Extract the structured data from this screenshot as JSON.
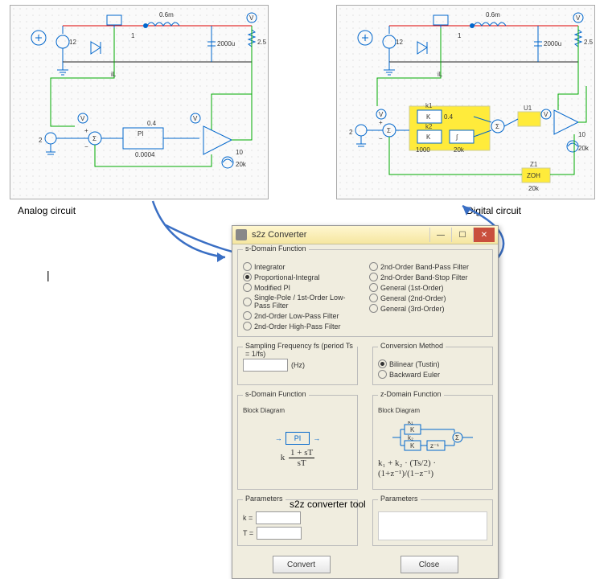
{
  "labels": {
    "analog": "Analog circuit",
    "digital": "Digital circuit",
    "tool": "s2z converter tool"
  },
  "circuit_values": {
    "inductor": "0.6m",
    "r1": "1",
    "cap": "2000u",
    "rout": "2.5",
    "vdc": "12",
    "iL": "iL",
    "vref": "2",
    "pi_gain": "0.4",
    "pi_tc": "0.0004",
    "pi_label": "PI",
    "gain_out": "10",
    "freq_out": "20k",
    "k1_label": "k1",
    "k2_label": "k2",
    "k_block": "K",
    "k1_val": "0.4",
    "k2_val": "1000",
    "int_bounds": "20k",
    "zoh_label": "ZOH",
    "zoh_rate": "20k",
    "u1": "U1",
    "z1": "Z1"
  },
  "dialog": {
    "title": "s2z Converter",
    "group_sdomain_fn": "s-Domain Function",
    "radios_left": [
      {
        "label": "Integrator",
        "sel": false
      },
      {
        "label": "Proportional-Integral",
        "sel": true
      },
      {
        "label": "Modified PI",
        "sel": false
      },
      {
        "label": "Single-Pole / 1st-Order Low-Pass Filter",
        "sel": false
      },
      {
        "label": "2nd-Order Low-Pass Filter",
        "sel": false
      },
      {
        "label": "2nd-Order High-Pass Filter",
        "sel": false
      }
    ],
    "radios_right": [
      {
        "label": "2nd-Order Band-Pass Filter",
        "sel": false
      },
      {
        "label": "2nd-Order Band-Stop Filter",
        "sel": false
      },
      {
        "label": "General (1st-Order)",
        "sel": false
      },
      {
        "label": "General (2nd-Order)",
        "sel": false
      },
      {
        "label": "General (3rd-Order)",
        "sel": false
      }
    ],
    "sampling_label": "Sampling Frequency fs (period Ts = 1/fs)",
    "sampling_unit": "(Hz)",
    "conv_method": "Conversion Method",
    "conv_opts": [
      {
        "label": "Bilinear (Tustin)",
        "sel": true
      },
      {
        "label": "Backward Euler",
        "sel": false
      }
    ],
    "s_block_title": "s-Domain Function",
    "z_block_title": "z-Domain Function",
    "block_diagram": "Block Diagram",
    "s_formula_top": "1 + sT",
    "s_formula_k": "k",
    "s_formula_bot": "sT",
    "z_formula": "k₁ + k₂ · (Ts/2) · (1+z⁻¹)/(1−z⁻¹)",
    "z_k1": "k₁",
    "z_k2": "k₂",
    "z_kbox": "K",
    "params_title": "Parameters",
    "param_k": "k =",
    "param_T": "T =",
    "convert_btn": "Convert",
    "close_btn": "Close"
  }
}
